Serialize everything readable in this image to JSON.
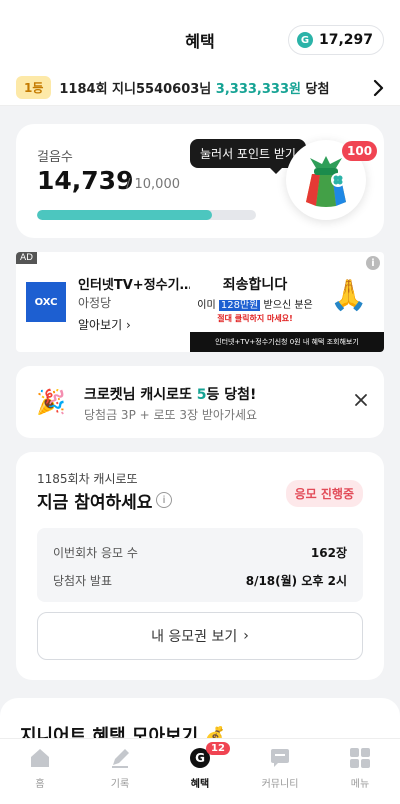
{
  "header": {
    "title": "혜택",
    "points": "17,297",
    "coin_letter": "G"
  },
  "winner_bar": {
    "rank": "1등",
    "text_prefix": "1184회 지니5540603님",
    "amount": "3,333,333원",
    "text_suffix": "당첨"
  },
  "steps": {
    "label": "걸음수",
    "value": "14,739",
    "goal": "/ 10,000",
    "progress": 0.8,
    "tooltip": "눌러서 포인트 받기",
    "badge": "100"
  },
  "ad": {
    "tag": "AD",
    "logo_text": "OXC",
    "title": "인터넷TV+정수기 최대혜택",
    "subtitle": "아정당",
    "cta": "알아보기",
    "banner_head": "죄송합니다",
    "banner_line1_a": "이미",
    "banner_line1_hl": "128만원",
    "banner_line1_b": "받으신 분은",
    "banner_line2": "절대 클릭하지 마세요!",
    "banner_foot": "인터넷+TV+정수기신청 0원 내 혜택 조회해보기"
  },
  "notice": {
    "title_prefix": "크로켓님 캐시로또",
    "title_num": "5",
    "title_suffix": "등 당첨!",
    "subtitle": "당첨금 3P + 로또 3장 받아가세요"
  },
  "lotto": {
    "round": "1185회차 캐시로또",
    "title": "지금 참여하세요",
    "status": "응모 진행중",
    "rows": [
      {
        "label": "이번회차 응모 수",
        "value": "162장"
      },
      {
        "label": "당첨자 발표",
        "value": "8/18(월) 오후 2시"
      }
    ],
    "button": "내 응모권 보기"
  },
  "section": {
    "title": "지니어트 혜택 모아보기"
  },
  "tabs": [
    {
      "label": "홈",
      "icon": "home-icon"
    },
    {
      "label": "기록",
      "icon": "pencil-icon"
    },
    {
      "label": "혜택",
      "icon": "benefit-icon",
      "badge": "12",
      "active": true
    },
    {
      "label": "커뮤니티",
      "icon": "chat-icon"
    },
    {
      "label": "메뉴",
      "icon": "grid-icon"
    }
  ],
  "colors": {
    "accent": "#16a394",
    "progress": "#4cc6bf",
    "badge_red": "#f04452",
    "status_bg": "#fde8ea"
  }
}
